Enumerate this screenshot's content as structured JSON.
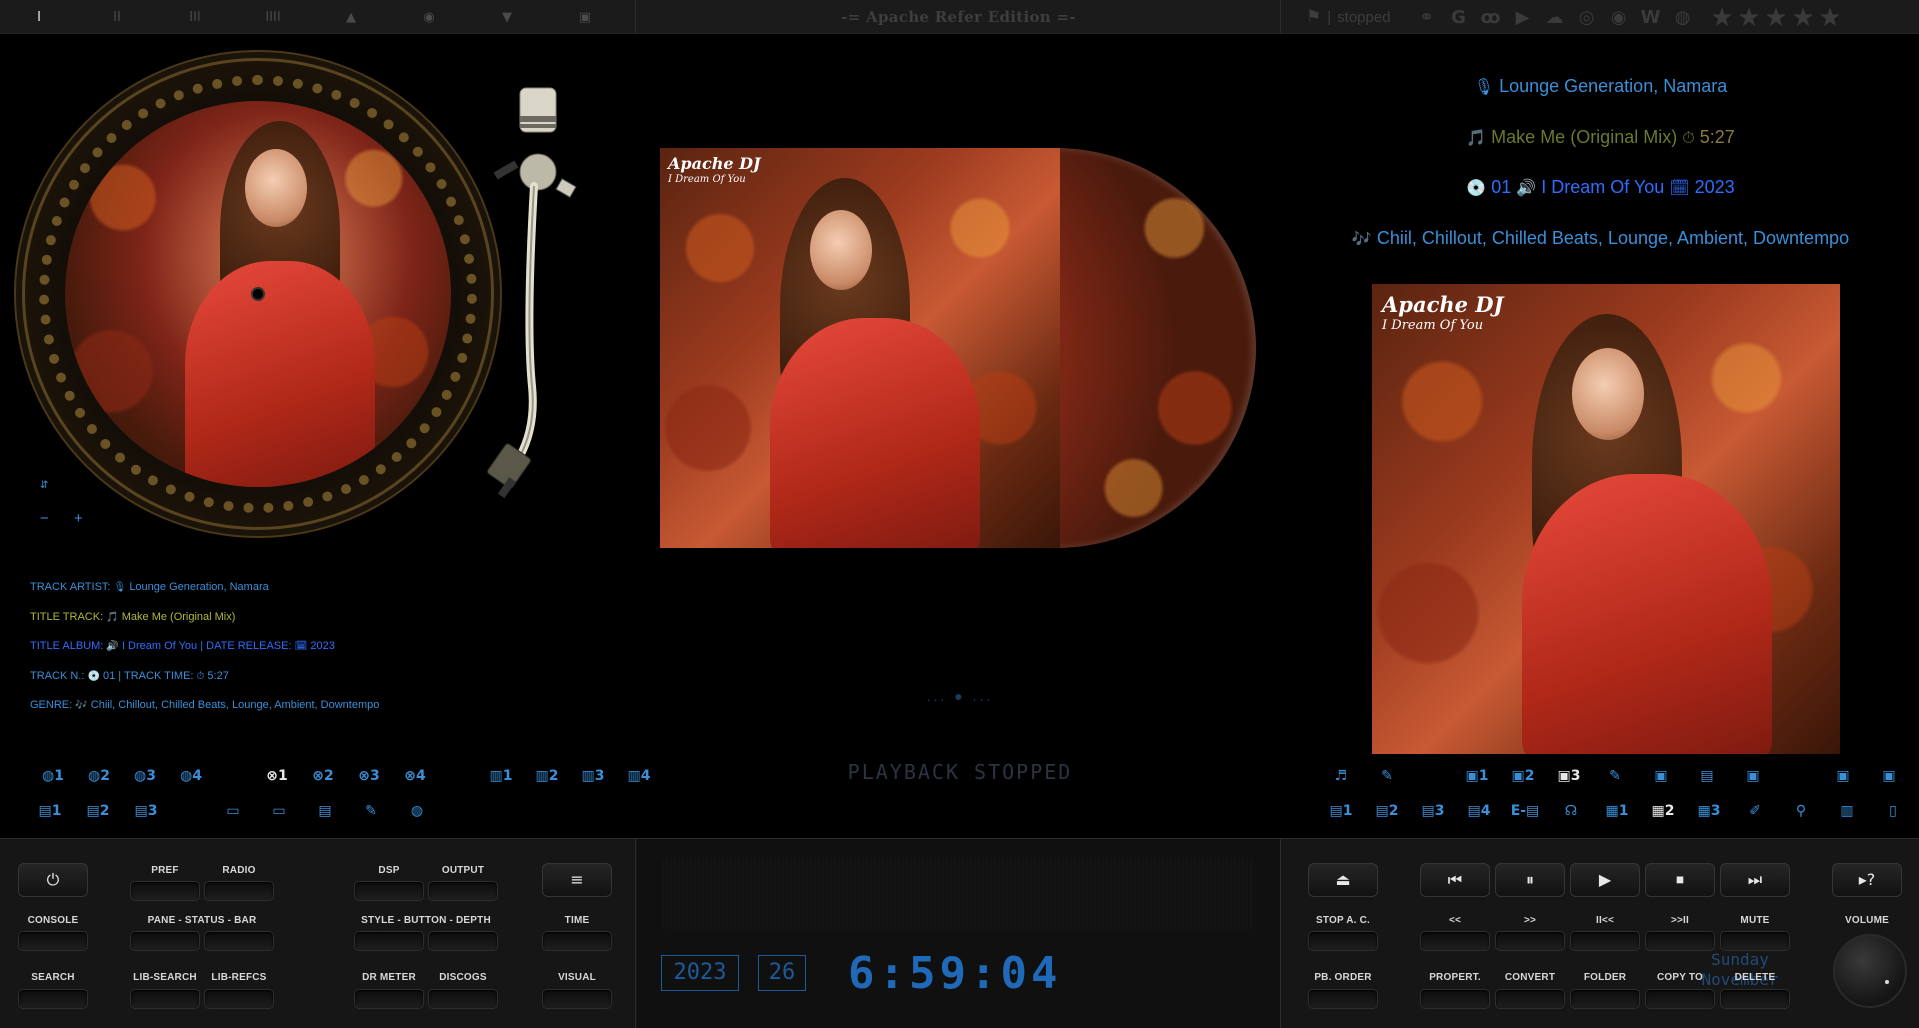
{
  "topbar": {
    "layout_buttons": [
      "I",
      "II",
      "III",
      "IIII",
      "▲",
      "◉",
      "▼",
      "▣"
    ],
    "edition_title": "-= Apache Refer Edition =-",
    "status": "stopped",
    "status_separator": "|",
    "web_icons": [
      "link-icon",
      "google-icon",
      "lastfm-icon",
      "youtube-icon",
      "soundcloud-icon",
      "spotify-icon",
      "target-icon",
      "wikipedia-icon",
      "podcast-icon"
    ],
    "web_icon_glyphs": [
      "⚭",
      "G",
      "ꝏ",
      "▶",
      "☁",
      "◎",
      "◉",
      "W",
      "◍"
    ],
    "rating": {
      "value": 0,
      "max": 5
    }
  },
  "left_pane": {
    "deck_controls": {
      "a": "⇵",
      "minus": "−",
      "plus": "+"
    },
    "track_info": {
      "artist_label": "TRACK ARTIST:",
      "artist": "Lounge Generation, Namara",
      "title_label": "TITLE TRACK:",
      "title": "Make Me (Original Mix)",
      "album_label": "TITLE ALBUM:",
      "album": "I Dream Of You",
      "date_label": "| DATE RELEASE:",
      "date": "2023",
      "number_label": "TRACK N.:",
      "number": "01",
      "time_label": "| TRACK TIME:",
      "time": "5:27",
      "genre_label": "GENRE:",
      "genre": "Chiil, Chillout, Chilled Beats, Lounge, Ambient, Downtempo"
    },
    "icon_row_1": [
      "◍1",
      "◍2",
      "◍3",
      "◍4",
      "⊗1",
      "⊗2",
      "⊗3",
      "⊗4",
      "▥1",
      "▥2",
      "▥3",
      "▥4"
    ],
    "icon_row_2": [
      "▤1",
      "▤2",
      "▤3",
      "▭",
      "▭",
      "▤",
      "✎",
      "◍"
    ]
  },
  "center_pane": {
    "cover": {
      "title": "Apache DJ",
      "subtitle": "I Dream Of You"
    },
    "dots": "... ● ...",
    "playback_status": "PLAYBACK STOPPED"
  },
  "right_pane": {
    "artist": "Lounge Generation, Namara",
    "title": "Make Me (Original Mix)",
    "length": "5:27",
    "track_number": "01",
    "album": "I Dream Of You",
    "year": "2023",
    "genre": "Chiil, Chillout, Chilled Beats, Lounge, Ambient, Downtempo",
    "cover": {
      "title": "Apache DJ",
      "subtitle": "I Dream Of You"
    },
    "icon_row_1": [
      "♬",
      "✎",
      "▣1",
      "▣2",
      "▣3",
      "✎",
      "▣",
      "▤",
      "▣",
      "▣",
      "▣"
    ],
    "icon_row_2": [
      "▤1",
      "▤2",
      "▤3",
      "▤4",
      "E-▤",
      "☊",
      "▦1",
      "▦2",
      "▦3",
      "✐",
      "⚲",
      "▥",
      "▯"
    ]
  },
  "bottom_left": {
    "power_glyph": "⏻",
    "menu_glyph": "≡",
    "labels": {
      "pref": "PREF",
      "radio": "RADIO",
      "dsp": "DSP",
      "output": "OUTPUT",
      "console": "CONSOLE",
      "pane_status_bar": "PANE - STATUS - BAR",
      "style_button_depth": "STYLE - BUTTON - DEPTH",
      "time": "TIME",
      "search": "SEARCH",
      "lib_search": "LIB-SEARCH",
      "lib_refcs": "LIB-REFCS",
      "dr_meter": "DR METER",
      "discogs": "DISCOGS",
      "visual": "VISUAL"
    }
  },
  "bottom_center": {
    "year": "2023",
    "day": "26",
    "clock": "6:59:04",
    "weekday": "Sunday",
    "month": "November"
  },
  "bottom_right": {
    "eject_glyph": "⏏",
    "help_glyph": "▸?",
    "transport": [
      "⏮",
      "⏸",
      "▶",
      "⏹",
      "⏭"
    ],
    "labels": {
      "stop_ac": "STOP A. C.",
      "prev_fast": "<<",
      "next_fast": ">>",
      "prev_track": "II<<",
      "next_track": ">>II",
      "mute": "MUTE",
      "volume": "VOLUME",
      "pb_order": "PB. ORDER",
      "properties": "PROPERT.",
      "convert": "CONVERT",
      "folder": "FOLDER",
      "copy_to": "COPY TO",
      "delete": "DELETE"
    }
  },
  "colors": {
    "accent_blue": "#3a8fd8",
    "title_yellow": "#b0b838",
    "album_blue": "#2f6dff",
    "lcd_blue": "#1f69b8"
  }
}
